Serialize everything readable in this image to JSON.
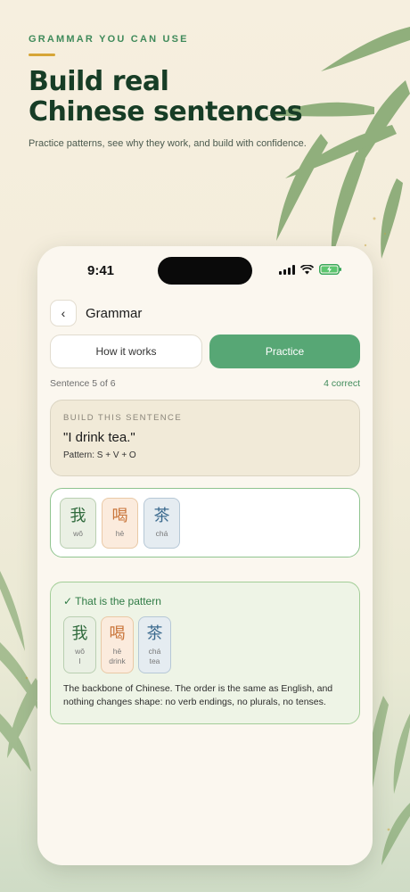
{
  "header": {
    "eyebrow": "GRAMMAR YOU CAN USE",
    "headline_line1": "Build real",
    "headline_line2": "Chinese sentences",
    "subhead": "Practice patterns, see why they work, and build with confidence."
  },
  "status_bar": {
    "time": "9:41"
  },
  "nav": {
    "back_label": "‹",
    "title": "Grammar"
  },
  "tabs": [
    {
      "label": "How it works",
      "active": false
    },
    {
      "label": "Practice",
      "active": true
    }
  ],
  "progress": {
    "sentence_label": "Sentence 5 of 6",
    "correct_label": "4 correct"
  },
  "prompt": {
    "eyebrow": "BUILD THIS SENTENCE",
    "sentence": "\"I drink tea.\"",
    "pattern": "Pattern: S + V + O"
  },
  "answer_tiles": [
    {
      "hanzi": "我",
      "pinyin": "wǒ"
    },
    {
      "hanzi": "喝",
      "pinyin": "hē"
    },
    {
      "hanzi": "茶",
      "pinyin": "chá"
    }
  ],
  "result": {
    "title": "✓ That is the pattern",
    "tiles": [
      {
        "hanzi": "我",
        "pinyin": "wǒ",
        "gloss": "I"
      },
      {
        "hanzi": "喝",
        "pinyin": "hē",
        "gloss": "drink"
      },
      {
        "hanzi": "茶",
        "pinyin": "chá",
        "gloss": "tea"
      }
    ],
    "explanation": "The backbone of Chinese. The order is the same as English, and nothing changes shape: no verb endings, no plurals, no tenses."
  },
  "colors": {
    "accent_green": "#57a775",
    "gold_rule": "#d6a536",
    "headline": "#173d26"
  }
}
